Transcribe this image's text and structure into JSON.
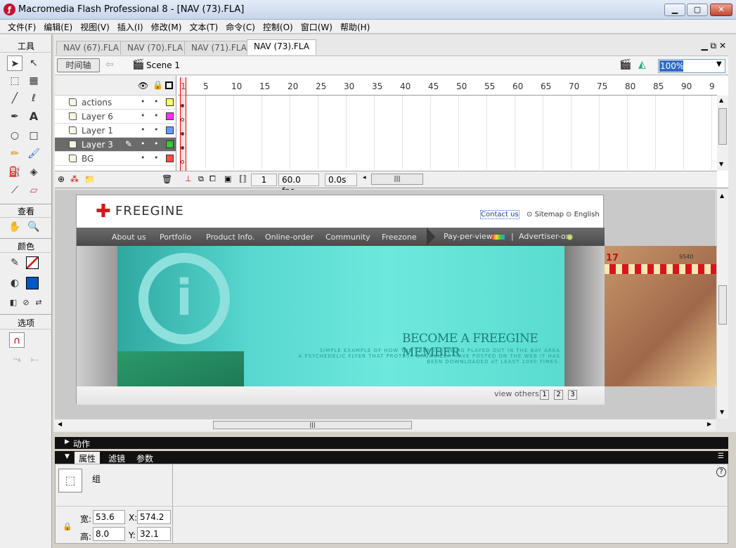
{
  "window": {
    "title": "Macromedia Flash Professional 8 - [NAV (73).FLA]",
    "min": "▁",
    "max": "▢",
    "close": "✕"
  },
  "menu": [
    "文件(F)",
    "编辑(E)",
    "视图(V)",
    "插入(I)",
    "修改(M)",
    "文本(T)",
    "命令(C)",
    "控制(O)",
    "窗口(W)",
    "帮助(H)"
  ],
  "toolbox": {
    "tools_header": "工具",
    "view_header": "查看",
    "colors_header": "颜色",
    "options_header": "选项"
  },
  "doc_tabs": [
    "NAV (67).FLA",
    "NAV (70).FLA",
    "NAV (71).FLA",
    "NAV (73).FLA"
  ],
  "doc_controls": "▁ ⧉ ✕",
  "edit_bar": {
    "timeline_button": "时间轴",
    "scene": "Scene 1",
    "zoom": "100%"
  },
  "timeline": {
    "layers": [
      {
        "name": "actions",
        "color": "#ffff66"
      },
      {
        "name": "Layer 6",
        "color": "#ff33ff"
      },
      {
        "name": "Layer 1",
        "color": "#6699ff"
      },
      {
        "name": "Layer 3",
        "color": "#33cc33",
        "selected": true
      },
      {
        "name": "BG",
        "color": "#ff4d4d"
      }
    ],
    "ruler": [
      "1",
      "5",
      "10",
      "15",
      "20",
      "25",
      "30",
      "35",
      "40",
      "45",
      "50",
      "55",
      "60",
      "65",
      "70",
      "75",
      "80",
      "85",
      "90",
      "9"
    ],
    "current_frame": "1",
    "fps": "60.0 fps",
    "elapsed": "0.0s"
  },
  "stage": {
    "logo": "FREEGINE",
    "top_links": [
      "Contact us",
      "Sitemap",
      "English"
    ],
    "nav": [
      "About us",
      "Portfolio",
      "Product Info.",
      "Online-order",
      "Community",
      "Freezone",
      "Pay-per-view",
      "Advertiser-on"
    ],
    "banner_title": "BECOME A FREEGINE MEMBER",
    "banner_text": [
      "SIMPLE EXAMPLE OF HOW THE TREND IS BEING PLAYED OUT IN THE BAY AREA",
      "A PSYCHEDELIC FLYER THAT PROTEST ORGANIZER HAVE POSTED ON THE WEB IT HAS",
      "BEEN DOWNLOADED AT LEAST 1000 TIMES."
    ],
    "view_others": "view others",
    "pages": [
      "1",
      "2",
      "3"
    ],
    "offstage_numbers": [
      "17",
      "9540"
    ]
  },
  "panels": {
    "actions": "动作",
    "props_tabs": [
      "属性",
      "滤镜",
      "参数"
    ],
    "object_type": "组",
    "width_label": "宽:",
    "width": "53.6",
    "height_label": "高:",
    "height": "8.0",
    "x_label": "X:",
    "x": "574.2",
    "y_label": "Y:",
    "y": "32.1",
    "help": "?"
  }
}
